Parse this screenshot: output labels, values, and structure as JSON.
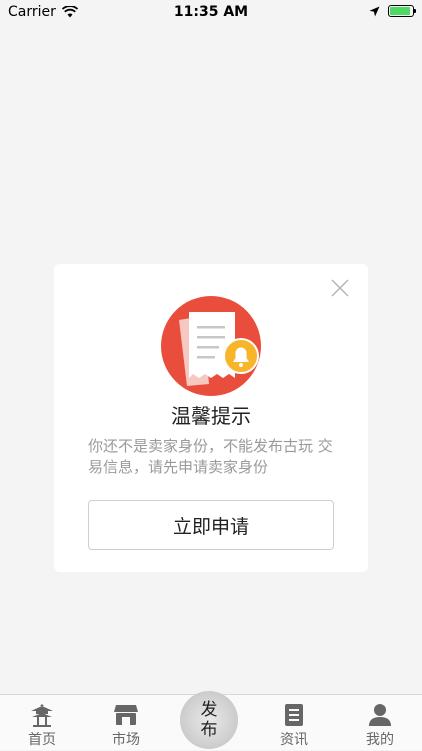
{
  "status_bar": {
    "carrier": "Carrier",
    "time": "11:35 AM"
  },
  "modal": {
    "title": "温馨提示",
    "message": "你还不是卖家身份，不能发布古玩 交易信息，请先申请卖家身份",
    "apply_button": "立即申请"
  },
  "tab_bar": {
    "home": "首页",
    "market": "市场",
    "publish_line1": "发",
    "publish_line2": "布",
    "news": "资讯",
    "mine": "我的"
  },
  "colors": {
    "illustration_red": "#e94e3c",
    "bell_yellow": "#f7b52c",
    "battery_green": "#4cd964"
  }
}
